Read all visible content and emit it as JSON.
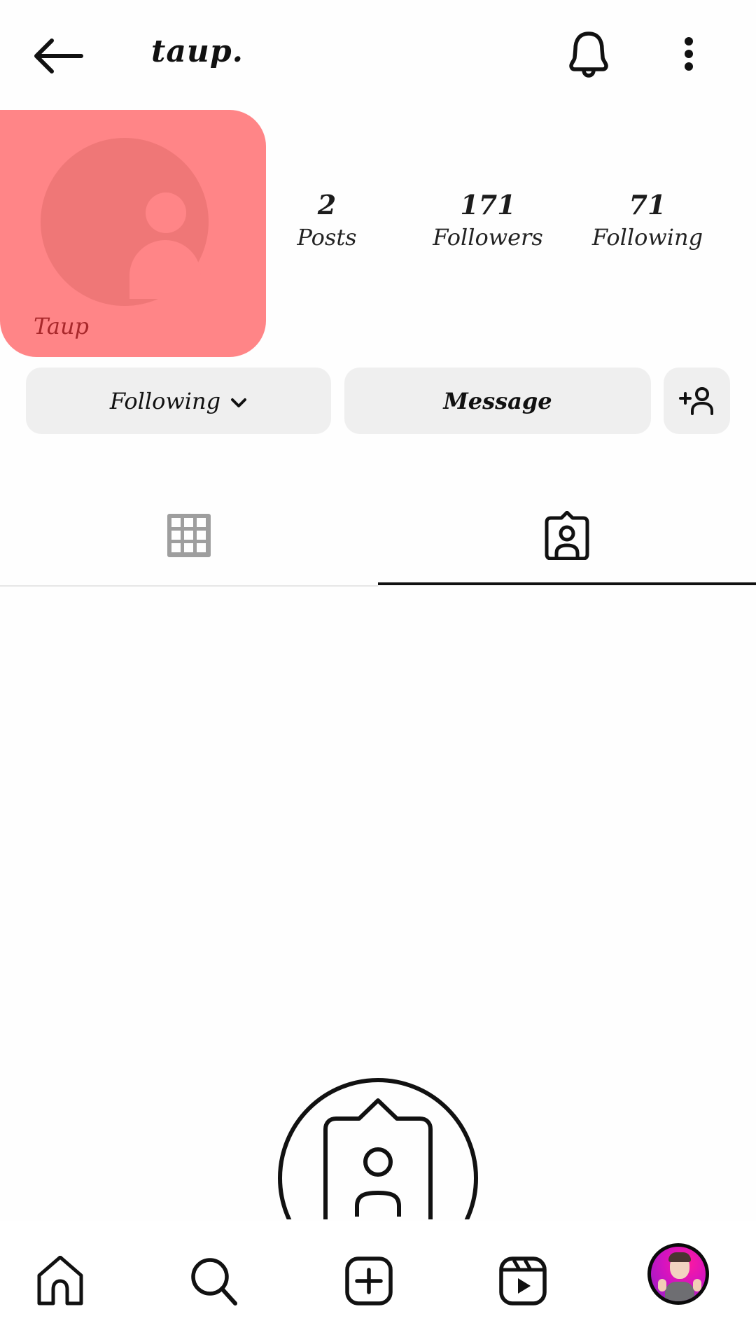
{
  "header": {
    "title": "taup.",
    "back_icon": "arrow-left-icon",
    "bell_icon": "bell-icon",
    "menu_icon": "kebab-menu-icon"
  },
  "profile": {
    "display_name": "Taup",
    "avatar_icon": "default-person-icon",
    "colors": {
      "card": "#ff8587",
      "circle": "#ef7777",
      "name": "#a8282b"
    }
  },
  "stats": [
    {
      "value": "2",
      "label": "Posts"
    },
    {
      "value": "171",
      "label": "Followers"
    },
    {
      "value": "71",
      "label": "Following"
    }
  ],
  "actions": {
    "following_label": "Following",
    "message_label": "Message",
    "add_person_icon": "add-person-icon",
    "following_chevron_icon": "chevron-down-icon"
  },
  "tabs": [
    {
      "name": "posts-grid",
      "icon": "grid-icon",
      "active": false
    },
    {
      "name": "tagged",
      "icon": "tagged-person-icon",
      "active": true
    }
  ],
  "empty_state": {
    "icon": "tagged-person-icon"
  },
  "bottom_nav": [
    {
      "name": "home",
      "icon": "home-icon"
    },
    {
      "name": "search",
      "icon": "search-icon"
    },
    {
      "name": "create",
      "icon": "plus-square-icon"
    },
    {
      "name": "reels",
      "icon": "reels-icon"
    },
    {
      "name": "profile",
      "icon": "avatar"
    }
  ]
}
